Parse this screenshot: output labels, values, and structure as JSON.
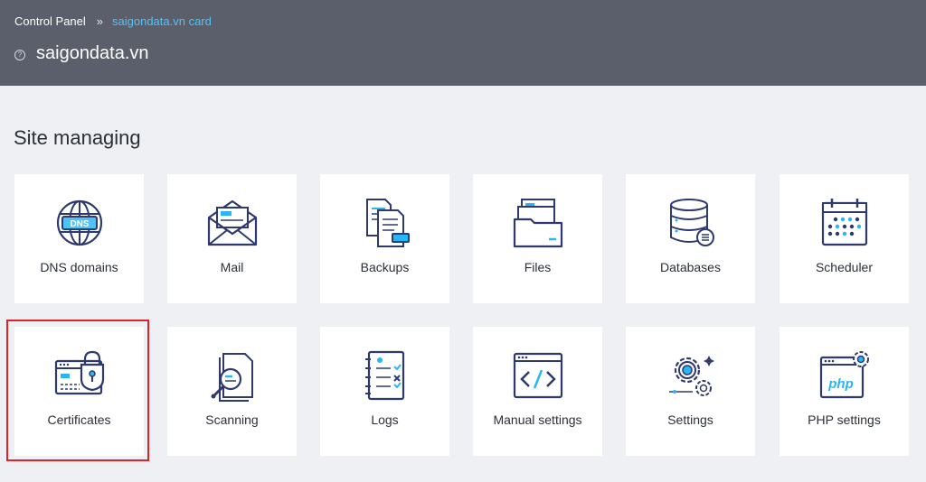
{
  "breadcrumb": {
    "root": "Control Panel",
    "separator": "»",
    "current": "saigondata.vn card"
  },
  "site": {
    "info_icon": "?",
    "title": "saigondata.vn"
  },
  "section": {
    "title": "Site managing"
  },
  "tiles": [
    {
      "label": "DNS domains",
      "icon": "dns-globe-icon",
      "icon_text": "DNS"
    },
    {
      "label": "Mail",
      "icon": "mail-envelope-icon"
    },
    {
      "label": "Backups",
      "icon": "backup-documents-icon"
    },
    {
      "label": "Files",
      "icon": "folder-icon"
    },
    {
      "label": "Databases",
      "icon": "database-icon"
    },
    {
      "label": "Scheduler",
      "icon": "calendar-icon"
    },
    {
      "label": "Certificates",
      "icon": "certificate-lock-icon",
      "highlighted": true
    },
    {
      "label": "Scanning",
      "icon": "scan-magnifier-icon"
    },
    {
      "label": "Logs",
      "icon": "log-notebook-icon"
    },
    {
      "label": "Manual settings",
      "icon": "code-window-icon"
    },
    {
      "label": "Settings",
      "icon": "gears-icon"
    },
    {
      "label": "PHP settings",
      "icon": "php-window-icon",
      "icon_text": "php"
    }
  ],
  "colors": {
    "header_bg": "#5a5f6b",
    "page_bg": "#eef0f3",
    "link": "#4fc3f7",
    "icon_stroke": "#2e3a6e",
    "icon_accent": "#29b6f6",
    "highlight_border": "#e2222a"
  }
}
